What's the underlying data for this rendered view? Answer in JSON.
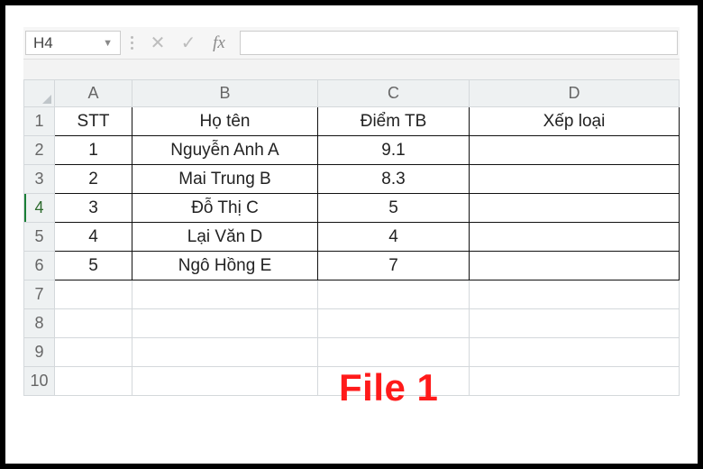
{
  "formula_bar": {
    "cell_ref": "H4",
    "cancel_icon": "✕",
    "confirm_icon": "✓",
    "fx_label": "fx",
    "formula_value": ""
  },
  "columns": {
    "A": "A",
    "B": "B",
    "C": "C",
    "D": "D"
  },
  "row_numbers": [
    "1",
    "2",
    "3",
    "4",
    "5",
    "6",
    "7",
    "8",
    "9",
    "10"
  ],
  "selected_row": "4",
  "headers": {
    "stt": "STT",
    "hoten": "Họ tên",
    "diemtb": "Điểm TB",
    "xeploai": "Xếp loại"
  },
  "rows": [
    {
      "stt": "1",
      "hoten": "Nguyễn Anh A",
      "diemtb": "9.1",
      "xeploai": ""
    },
    {
      "stt": "2",
      "hoten": "Mai Trung B",
      "diemtb": "8.3",
      "xeploai": ""
    },
    {
      "stt": "3",
      "hoten": "Đỗ Thị C",
      "diemtb": "5",
      "xeploai": ""
    },
    {
      "stt": "4",
      "hoten": "Lại Văn D",
      "diemtb": "4",
      "xeploai": ""
    },
    {
      "stt": "5",
      "hoten": "Ngô Hồng E",
      "diemtb": "7",
      "xeploai": ""
    }
  ],
  "annotation": "File 1"
}
